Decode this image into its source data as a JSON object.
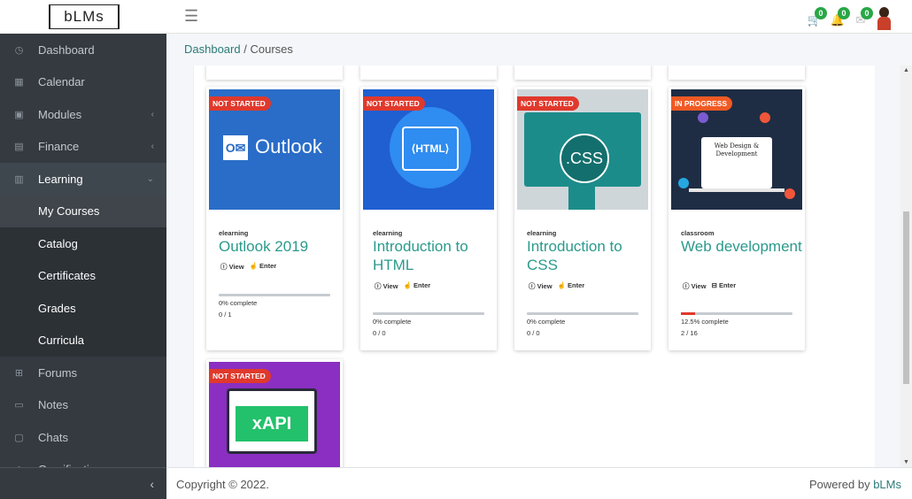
{
  "app": {
    "logo": "bLMs"
  },
  "topbar": {
    "cart_count": "0",
    "notif_count": "0",
    "msg_count": "0"
  },
  "sidebar": {
    "items": [
      {
        "label": "Dashboard",
        "icon": "dashboard-icon"
      },
      {
        "label": "Calendar",
        "icon": "calendar-icon"
      },
      {
        "label": "Modules",
        "icon": "modules-icon"
      },
      {
        "label": "Finance",
        "icon": "finance-icon"
      },
      {
        "label": "Learning",
        "icon": "learning-icon"
      },
      {
        "label": "Forums",
        "icon": "forums-icon"
      },
      {
        "label": "Notes",
        "icon": "notes-icon"
      },
      {
        "label": "Chats",
        "icon": "chats-icon"
      },
      {
        "label": "Gamification",
        "icon": "gamification-icon"
      }
    ],
    "learning_sub": [
      "My Courses",
      "Catalog",
      "Certificates",
      "Grades",
      "Curricula"
    ],
    "collapse_icon": "chevron-left-icon"
  },
  "breadcrumb": {
    "home": "Dashboard",
    "sep": "/",
    "current": "Courses"
  },
  "courses": [
    {
      "status": "NOT STARTED",
      "type": "elearning",
      "title": "Outlook 2019",
      "view": "View",
      "enter": "Enter",
      "progress_pct": 0,
      "progress_label": "0% complete",
      "count": "0 / 1",
      "thumb_text": "Outlook"
    },
    {
      "status": "NOT STARTED",
      "type": "elearning",
      "title": "Introduction to HTML",
      "view": "View",
      "enter": "Enter",
      "progress_pct": 0,
      "progress_label": "0% complete",
      "count": "0 / 0",
      "thumb_text": "⟨HTML⟩"
    },
    {
      "status": "NOT STARTED",
      "type": "elearning",
      "title": "Introduction to CSS",
      "view": "View",
      "enter": "Enter",
      "progress_pct": 0,
      "progress_label": "0% complete",
      "count": "0 / 0",
      "thumb_text": ".CSS"
    },
    {
      "status": "IN PROGRESS",
      "type": "classroom",
      "title": "Web development",
      "view": "View",
      "enter": "Enter",
      "progress_pct": 12.5,
      "progress_label": "12.5% complete",
      "count": "2 / 16",
      "thumb_text": "Web Design & Development"
    },
    {
      "status": "NOT STARTED",
      "thumb_text": "xAPI"
    }
  ],
  "footer": {
    "copyright": "Copyright © 2022.",
    "powered_prefix": "Powered by ",
    "powered_brand": "bLMs"
  },
  "colors": {
    "accent": "#2a9a8c",
    "sidebar": "#343a40",
    "badge_red": "#e0392c"
  }
}
